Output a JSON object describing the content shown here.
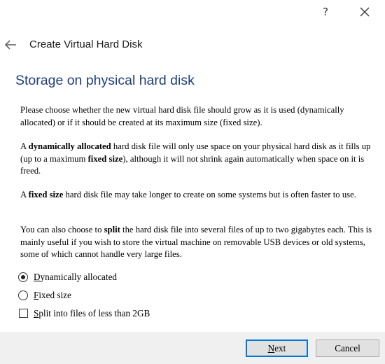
{
  "window": {
    "help_label": "?"
  },
  "header": {
    "back_icon": "arrow-left-icon",
    "title": "Create Virtual Hard Disk"
  },
  "page": {
    "title": "Storage on physical hard disk",
    "paragraphs": [
      [
        {
          "t": "Please choose whether the new virtual hard disk file should grow as it is used (dynamically allocated) or if it should be created at its maximum size (fixed size).",
          "b": false
        }
      ],
      [
        {
          "t": "A ",
          "b": false
        },
        {
          "t": "dynamically allocated",
          "b": true
        },
        {
          "t": " hard disk file will only use space on your physical hard disk as it fills up (up to a maximum ",
          "b": false
        },
        {
          "t": "fixed size",
          "b": true
        },
        {
          "t": "), although it will not shrink again automatically when space on it is freed.",
          "b": false
        }
      ],
      [
        {
          "t": "A ",
          "b": false
        },
        {
          "t": "fixed size",
          "b": true
        },
        {
          "t": " hard disk file may take longer to create on some systems but is often faster to use.",
          "b": false
        }
      ],
      [
        {
          "t": "You can also choose to ",
          "b": false
        },
        {
          "t": "split",
          "b": true
        },
        {
          "t": " the hard disk file into several files of up to two gigabytes each. This is mainly useful if you wish to store the virtual machine on removable USB devices or old systems, some of which cannot handle very large files.",
          "b": false
        }
      ]
    ]
  },
  "options": {
    "dynamic": {
      "mnemonic": "D",
      "rest": "ynamically allocated",
      "selected": true
    },
    "fixed": {
      "mnemonic": "F",
      "rest": "ixed size",
      "selected": false
    },
    "split": {
      "mnemonic": "S",
      "rest": "plit into files of less than 2GB",
      "checked": false
    }
  },
  "buttons": {
    "next": {
      "mnemonic": "N",
      "rest": "ext"
    },
    "cancel": {
      "label": "Cancel"
    }
  },
  "colors": {
    "title": "#1f3e79",
    "footer_bg": "#f0f0f0",
    "default_button_border": "#0078d7"
  }
}
